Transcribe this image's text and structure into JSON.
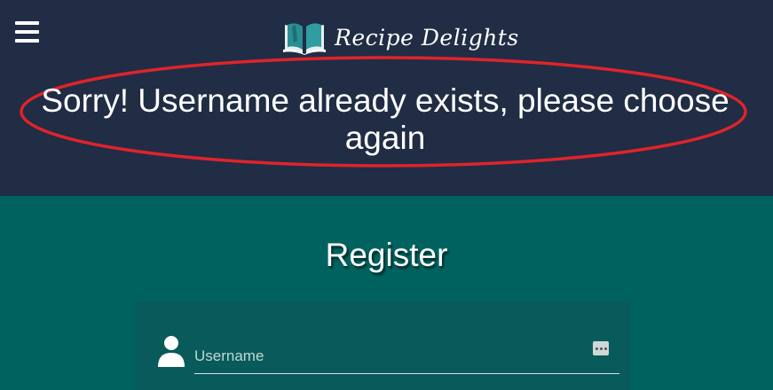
{
  "header": {
    "brand_name": "Recipe Delights",
    "menu_icon": "hamburger-menu-icon",
    "logo_icon": "open-book-icon"
  },
  "flash": {
    "message": "Sorry! Username already exists, please choose again",
    "highlight_color": "#e0232b"
  },
  "form": {
    "title": "Register",
    "username": {
      "placeholder": "Username",
      "value": "",
      "icon": "user-icon",
      "trailing_icon": "password-manager-icon"
    }
  },
  "colors": {
    "header_bg": "#202d44",
    "page_bg": "#00625f",
    "card_bg": "#095a5b",
    "logo_accent": "#2a8e92"
  }
}
